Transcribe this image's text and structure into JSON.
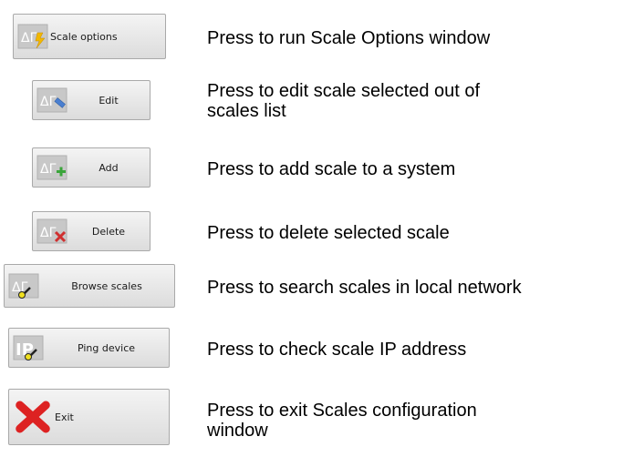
{
  "buttons": {
    "scale_options": "Scale options",
    "edit": "Edit",
    "add": "Add",
    "delete": "Delete",
    "browse_scales": "Browse scales",
    "ping_device": "Ping device",
    "exit": "Exit"
  },
  "descriptions": {
    "scale_options": "Press to run Scale Options window",
    "edit_line1": "Press to edit scale selected out of",
    "edit_line2": "scales list",
    "add": "Press to add scale to a system",
    "delete": "Press to delete selected scale",
    "browse_scales": "Press to search scales in local network",
    "ping_device": "Press to check scale IP address",
    "exit_line1": "Press to exit Scales configuration",
    "exit_line2": "window"
  },
  "icons": {
    "scale_options": "scale-lightning-icon",
    "edit": "scale-pencil-icon",
    "add": "scale-plus-icon",
    "delete": "scale-x-icon",
    "browse_scales": "scale-magnifier-icon",
    "ping_device": "ip-magnifier-icon",
    "exit": "red-x-icon"
  },
  "colors": {
    "accent_lightning": "#f2b800",
    "add_green": "#3aa53a",
    "delete_red": "#d03030",
    "exit_red": "#dd2222"
  }
}
